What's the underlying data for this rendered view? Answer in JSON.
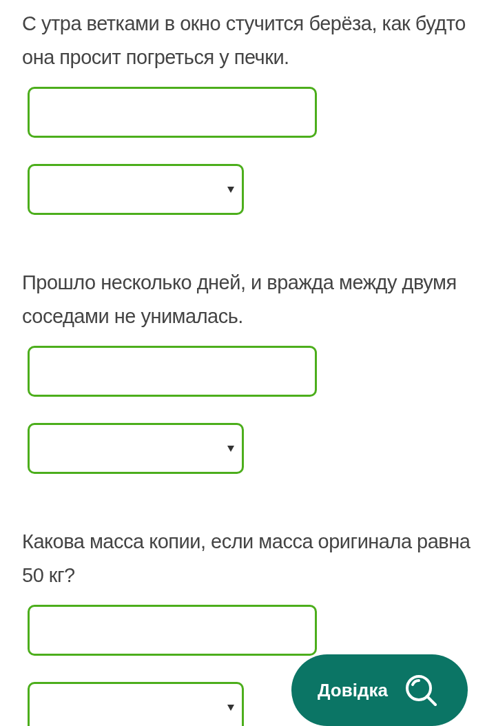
{
  "questions": [
    {
      "text": "С утра ветками в окно стучится берёза, как будто она просит погреться у печки.",
      "fields": [
        {
          "kind": "text"
        },
        {
          "kind": "select"
        }
      ]
    },
    {
      "text": "Прошло несколько дней, и вражда между двумя соседами не унималась.",
      "fields": [
        {
          "kind": "text"
        },
        {
          "kind": "select"
        }
      ]
    },
    {
      "text": "Какова масса копии, если масса оригинала равна 50 кг?",
      "fields": [
        {
          "kind": "text"
        },
        {
          "kind": "select"
        }
      ]
    }
  ],
  "help_button": {
    "label": "Довідка"
  }
}
